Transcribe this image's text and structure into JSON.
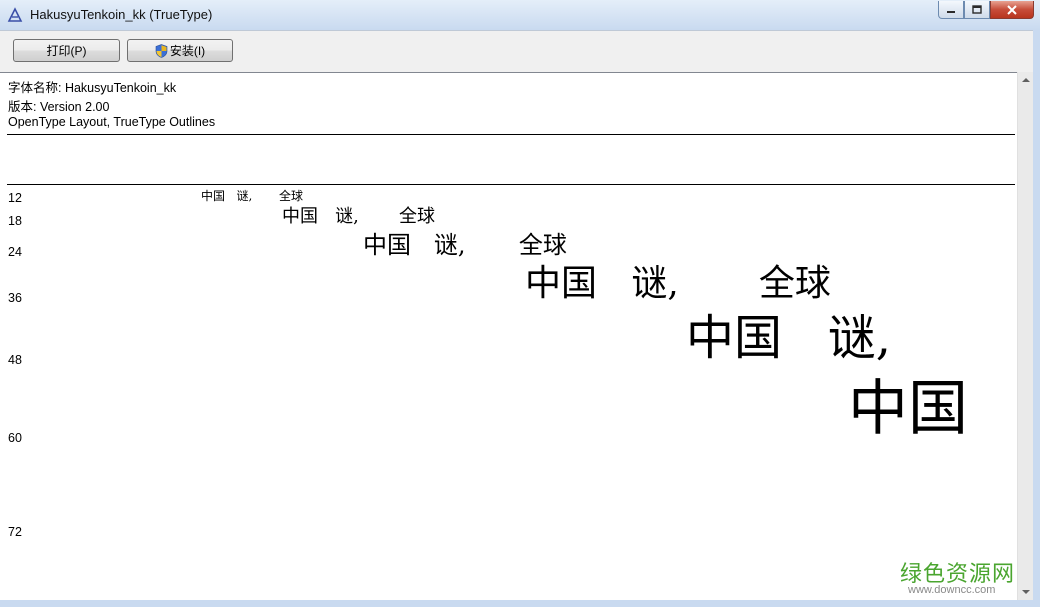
{
  "window": {
    "title": "HakusyuTenkoin_kk (TrueType)"
  },
  "toolbar": {
    "print_label": "打印(P)",
    "install_label": "安装(I)"
  },
  "font_info": {
    "name_line": "字体名称: HakusyuTenkoin_kk",
    "version_line": "版本: Version 2.00",
    "type_line": "OpenType Layout, TrueType Outlines"
  },
  "samples": [
    {
      "size": "12",
      "text": "中国   谜,       全球"
    },
    {
      "size": "18",
      "text": "中国   谜,       全球"
    },
    {
      "size": "24",
      "text": "中国   谜,       全球"
    },
    {
      "size": "36",
      "text": "中国   谜,       全球"
    },
    {
      "size": "48",
      "text": "中国   谜,"
    },
    {
      "size": "60",
      "text": "中国"
    },
    {
      "size": "72",
      "text": ""
    }
  ],
  "watermark": {
    "brand": "绿色资源网",
    "url": "www.downcc.com"
  },
  "icons": {
    "app": "font-viewer-icon",
    "install": "uac-shield-icon",
    "minimize": "minimize-icon",
    "maximize": "maximize-icon",
    "close": "close-icon"
  },
  "colors": {
    "titlebar": "#c9daf0",
    "close_button": "#c74d3a",
    "watermark": "#4aa52f"
  }
}
